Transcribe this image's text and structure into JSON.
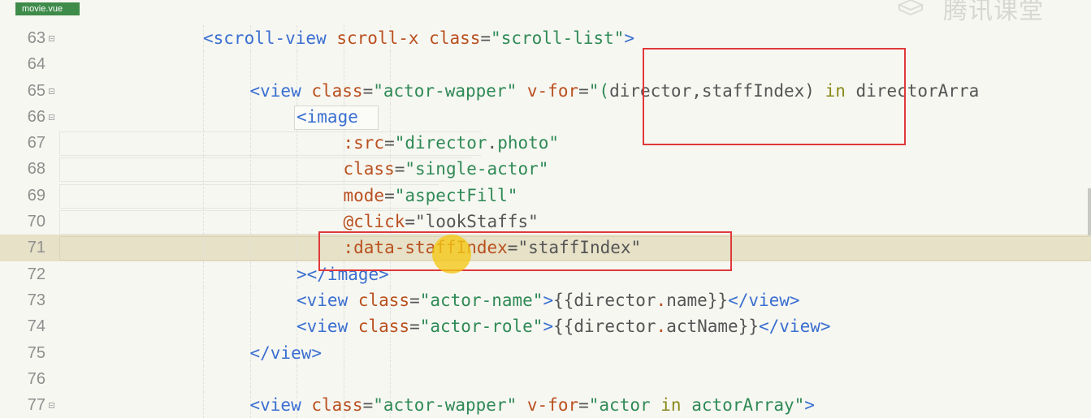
{
  "tab": {
    "label": "movie.vue"
  },
  "watermark": {
    "text": "腾讯课堂"
  },
  "lines": [
    {
      "num": "63",
      "fold": true,
      "indent": 2,
      "tokens": [
        [
          "t",
          "<scroll-view "
        ],
        [
          "a",
          "scroll-x "
        ],
        [
          "a",
          "class"
        ],
        [
          "p",
          "="
        ],
        [
          "s",
          "\"scroll-list\""
        ],
        [
          "t",
          ">"
        ]
      ]
    },
    {
      "num": "64",
      "fold": false,
      "indent": 0,
      "tokens": []
    },
    {
      "num": "65",
      "fold": true,
      "indent": 3,
      "tokens": [
        [
          "t",
          "<view "
        ],
        [
          "a",
          "class"
        ],
        [
          "p",
          "="
        ],
        [
          "s",
          "\"actor-wapper\" "
        ],
        [
          "a",
          "v-for"
        ],
        [
          "p",
          "="
        ],
        [
          "s",
          "\"("
        ],
        [
          "p",
          "director,staffIndex) "
        ],
        [
          "k",
          "in "
        ],
        [
          "p",
          "directorArra"
        ]
      ]
    },
    {
      "num": "66",
      "fold": true,
      "indent": 4,
      "tokens": [
        [
          "t",
          "<image"
        ]
      ]
    },
    {
      "num": "67",
      "fold": false,
      "indent": 5,
      "tokens": [
        [
          "a",
          ":src"
        ],
        [
          "p",
          "="
        ],
        [
          "s",
          "\"director"
        ],
        [
          "p",
          "."
        ],
        [
          "s",
          "photo\""
        ]
      ]
    },
    {
      "num": "68",
      "fold": false,
      "indent": 5,
      "tokens": [
        [
          "a",
          "class"
        ],
        [
          "p",
          "="
        ],
        [
          "s",
          "\"single-actor\""
        ]
      ]
    },
    {
      "num": "69",
      "fold": false,
      "indent": 5,
      "tokens": [
        [
          "a",
          "mode"
        ],
        [
          "p",
          "="
        ],
        [
          "s",
          "\"aspectFill\""
        ]
      ]
    },
    {
      "num": "70",
      "fold": false,
      "indent": 5,
      "tokens": [
        [
          "a",
          "@click"
        ],
        [
          "p",
          "="
        ],
        [
          "p",
          "\"lookStaffs\""
        ]
      ]
    },
    {
      "num": "71",
      "fold": false,
      "indent": 5,
      "tokens": [
        [
          "a",
          ":data-staffIndex"
        ],
        [
          "p",
          "="
        ],
        [
          "p",
          "\"staffIndex\""
        ]
      ]
    },
    {
      "num": "72",
      "fold": false,
      "indent": 4,
      "tokens": [
        [
          "t",
          "></image>"
        ]
      ]
    },
    {
      "num": "73",
      "fold": false,
      "indent": 4,
      "tokens": [
        [
          "t",
          "<view "
        ],
        [
          "a",
          "class"
        ],
        [
          "p",
          "="
        ],
        [
          "s",
          "\"actor-name\""
        ],
        [
          "t",
          ">"
        ],
        [
          "p",
          "{{director"
        ],
        [
          "a",
          "."
        ],
        [
          "p",
          "name}}"
        ],
        [
          "t",
          "</view>"
        ]
      ]
    },
    {
      "num": "74",
      "fold": false,
      "indent": 4,
      "tokens": [
        [
          "t",
          "<view "
        ],
        [
          "a",
          "class"
        ],
        [
          "p",
          "="
        ],
        [
          "s",
          "\"actor-role\""
        ],
        [
          "t",
          ">"
        ],
        [
          "p",
          "{{director"
        ],
        [
          "a",
          "."
        ],
        [
          "p",
          "actName}}"
        ],
        [
          "t",
          "</view>"
        ]
      ]
    },
    {
      "num": "75",
      "fold": false,
      "indent": 3,
      "tokens": [
        [
          "t",
          "</view>"
        ]
      ]
    },
    {
      "num": "76",
      "fold": false,
      "indent": 0,
      "tokens": []
    },
    {
      "num": "77",
      "fold": true,
      "indent": 3,
      "tokens": [
        [
          "t",
          "<view "
        ],
        [
          "a",
          "class"
        ],
        [
          "p",
          "="
        ],
        [
          "s",
          "\"actor-wapper\" "
        ],
        [
          "a",
          "v-for"
        ],
        [
          "p",
          "="
        ],
        [
          "s",
          "\"actor "
        ],
        [
          "k",
          "in "
        ],
        [
          "s",
          "actorArray\""
        ],
        [
          "t",
          ">"
        ]
      ]
    }
  ]
}
